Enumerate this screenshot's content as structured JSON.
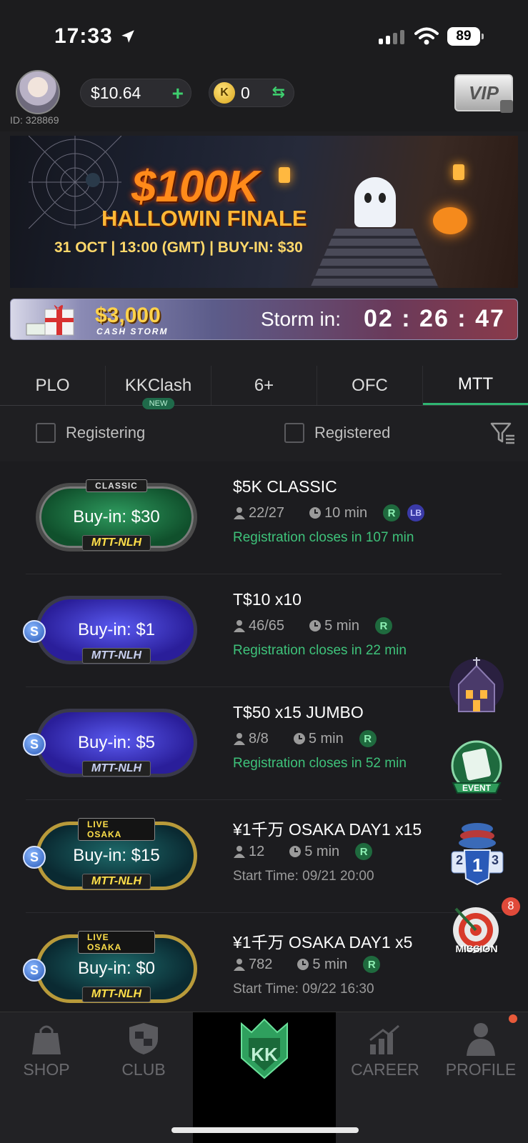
{
  "status_bar": {
    "time": "17:33",
    "battery": "89"
  },
  "header": {
    "user_id": "ID: 328869",
    "balance": "$10.64",
    "coins": "0",
    "coin_letter": "K",
    "vip_label": "VIP"
  },
  "banner": {
    "amount": "$100K",
    "title": "HALLOWIN FINALE",
    "subtitle": "31 OCT | 13:00 (GMT) | BUY-IN: $30"
  },
  "cash_storm": {
    "amount": "$3,000",
    "label": "CASH STORM",
    "storm_in": "Storm in:",
    "timer": "02 : 26 : 47"
  },
  "tabs": [
    {
      "label": "PLO"
    },
    {
      "label": "KKClash",
      "badge": "NEW"
    },
    {
      "label": "6+"
    },
    {
      "label": "OFC"
    },
    {
      "label": "MTT",
      "active": true
    }
  ],
  "filters": {
    "registering": "Registering",
    "registered": "Registered"
  },
  "tournaments": [
    {
      "name": "$5K CLASSIC",
      "buyin": "Buy-in: $30",
      "top_tag": "CLASSIC",
      "bottom_tag": "MTT-NLH",
      "players": "22/27",
      "duration": "10 min",
      "r": "R",
      "lb": "LB",
      "sub": "Registration closes in 107 min"
    },
    {
      "name": "T$10 x10",
      "buyin": "Buy-in: $1",
      "bottom_tag": "MTT-NLH",
      "coin": "S",
      "players": "46/65",
      "duration": "5 min",
      "r": "R",
      "sub": "Registration closes in 22 min"
    },
    {
      "name": "T$50 x15 JUMBO",
      "buyin": "Buy-in: $5",
      "bottom_tag": "MTT-NLH",
      "coin": "S",
      "players": "8/8",
      "duration": "5 min",
      "r": "R",
      "sub": "Registration closes in 52 min"
    },
    {
      "name": "¥1千万 OSAKA  DAY1 x15",
      "buyin": "Buy-in: $15",
      "top_tag": "LIVE OSAKA",
      "bottom_tag": "MTT-NLH",
      "coin": "S",
      "players": "12",
      "duration": "5 min",
      "r": "R",
      "sub": "Start Time: 09/21 20:00"
    },
    {
      "name": "¥1千万 OSAKA  DAY1 x5",
      "buyin": "Buy-in: $0",
      "top_tag": "LIVE OSAKA",
      "bottom_tag": "MTT-NLH",
      "coin": "S",
      "players": "782",
      "duration": "5 min",
      "r": "R",
      "sub": "Start Time: 09/22 16:30"
    }
  ],
  "floating": {
    "event_label": "EVENT",
    "rank_left": "2",
    "rank_center": "1",
    "rank_right": "3",
    "mission_label": "MISSION",
    "mission_count": "8"
  },
  "nav": {
    "shop": "SHOP",
    "club": "CLUB",
    "career": "CAREER",
    "profile": "PROFILE",
    "center_letters": "KK"
  }
}
